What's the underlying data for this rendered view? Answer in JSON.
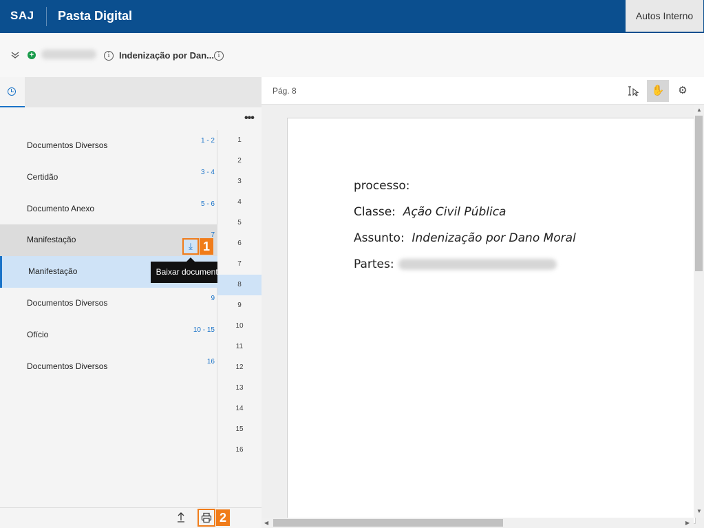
{
  "header": {
    "brand": "SAJ",
    "title": "Pasta Digital",
    "autos_button": "Autos Interno"
  },
  "subheader": {
    "case_subject": "Indenização por Dan..."
  },
  "documents": [
    {
      "name": "Documentos Diversos",
      "pages": "1 - 2"
    },
    {
      "name": "Certidão",
      "pages": "3 - 4"
    },
    {
      "name": "Documento Anexo",
      "pages": "5 - 6"
    },
    {
      "name": "Manifestação",
      "pages": "7"
    },
    {
      "name": "Manifestação",
      "pages": ""
    },
    {
      "name": "Documentos Diversos",
      "pages": "9"
    },
    {
      "name": "Ofício",
      "pages": "10 - 15"
    },
    {
      "name": "Documentos Diversos",
      "pages": "16"
    }
  ],
  "page_numbers": [
    "1",
    "2",
    "3",
    "4",
    "5",
    "6",
    "7",
    "8",
    "9",
    "10",
    "11",
    "12",
    "13",
    "14",
    "15",
    "16"
  ],
  "active_page": "8",
  "tooltip": "Baixar documento",
  "callouts": {
    "download": "1",
    "print": "2"
  },
  "viewer": {
    "page_label": "Pág. 8",
    "content": {
      "line1": "processo:",
      "classe_label": "Classe:",
      "classe_value": "Ação Civil Pública",
      "assunto_label": "Assunto:",
      "assunto_value": "Indenização por Dano Moral",
      "partes_label": "Partes:"
    }
  },
  "colors": {
    "header": "#0b4f8f",
    "accent": "#1a73c8",
    "highlight": "#f07c1a",
    "selected_row": "#cfe3f7"
  }
}
